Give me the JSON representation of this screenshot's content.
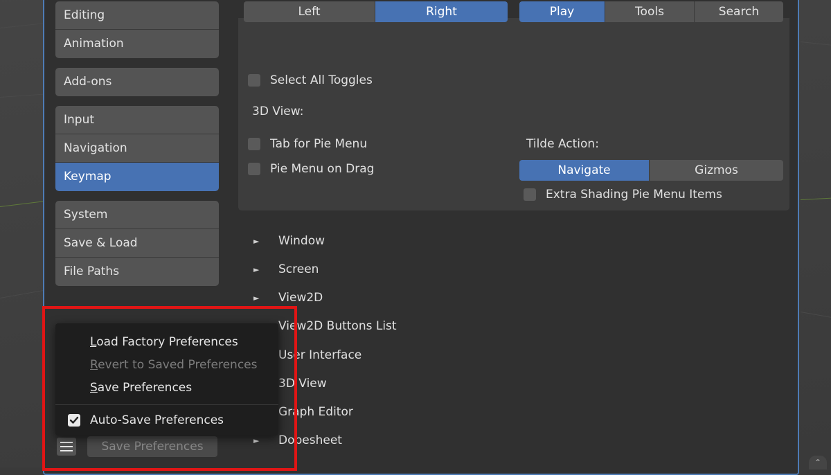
{
  "sidebar": {
    "groups": [
      [
        "Editing",
        "Animation"
      ],
      [
        "Add-ons"
      ],
      [
        "Input",
        "Navigation",
        "Keymap"
      ],
      [
        "System",
        "Save & Load",
        "File Paths"
      ]
    ],
    "active": "Keymap"
  },
  "main": {
    "side_toggle": {
      "options": [
        "Left",
        "Right"
      ],
      "selected": "Right"
    },
    "mode_toggle": {
      "options": [
        "Play",
        "Tools",
        "Search"
      ],
      "selected": "Play"
    },
    "select_all_toggles": "Select All Toggles",
    "view3d_label": "3D View:",
    "tab_for_pie_menu": "Tab for Pie Menu",
    "pie_menu_on_drag": "Pie Menu on Drag",
    "tilde_action_label": "Tilde Action:",
    "tilde_toggle": {
      "options": [
        "Navigate",
        "Gizmos"
      ],
      "selected": "Navigate"
    },
    "extra_shading": "Extra Shading Pie Menu Items",
    "keymap_tree": [
      "Window",
      "Screen",
      "View2D",
      "View2D Buttons List",
      "User Interface",
      "3D View",
      "Graph Editor",
      "Dopesheet"
    ]
  },
  "popup_menu": {
    "load_factory": {
      "first": "L",
      "rest": "oad Factory Preferences"
    },
    "revert_saved": {
      "first": "R",
      "rest": "evert to Saved Preferences"
    },
    "save_prefs": {
      "first": "S",
      "rest": "ave Preferences"
    },
    "auto_save": "Auto-Save Preferences",
    "auto_save_checked": true
  },
  "footer": {
    "save_button": "Save Preferences",
    "menu_icon": "hamburger-icon"
  },
  "colors": {
    "accent": "#4772b3",
    "highlight": "#e01515"
  }
}
